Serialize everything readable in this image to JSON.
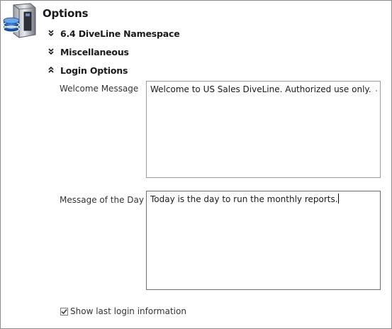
{
  "window": {
    "title": "Options"
  },
  "icons": {
    "app": "database-server-icon",
    "collapsed": "double-chevron-down-icon",
    "expanded": "double-chevron-up-icon",
    "check": "checkmark-icon"
  },
  "sections": [
    {
      "label": "6.4 DiveLine Namespace",
      "state": "collapsed"
    },
    {
      "label": "Miscellaneous",
      "state": "collapsed"
    },
    {
      "label": "Login Options",
      "state": "expanded"
    }
  ],
  "login_options": {
    "welcome_message": {
      "label": "Welcome Message",
      "value": "Welcome to US Sales DiveLine. Authorized use only."
    },
    "message_of_the_day": {
      "label": "Message of the Day",
      "value": "Today is the day to run the monthly reports."
    },
    "show_last_login": {
      "label": "Show last login information",
      "checked": true
    }
  }
}
